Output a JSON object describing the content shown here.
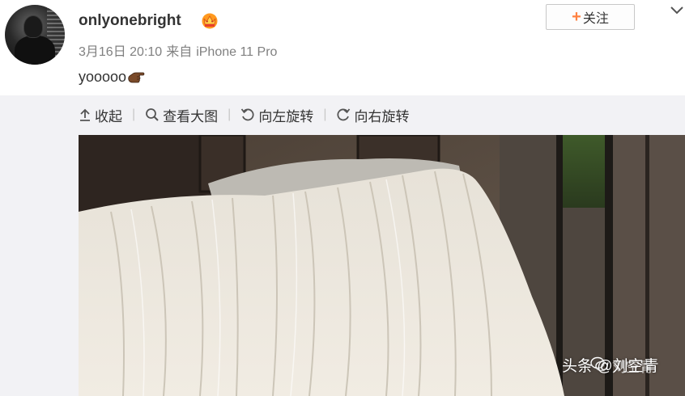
{
  "post": {
    "username": "onlyonebright",
    "meta": {
      "date": "3月16日 20:10",
      "source_prefix": "来自",
      "source": "iPhone 11 Pro"
    },
    "content": "yooooo",
    "follow_label": "关注"
  },
  "toolbar": {
    "collapse": "收起",
    "view_large": "查看大图",
    "rotate_left": "向左旋转",
    "rotate_right": "向右旋转"
  },
  "watermark": {
    "main": "头条 @刘空青",
    "secondary": "刘空青"
  },
  "colors": {
    "accent": "#ff8140",
    "meta_text": "#808080",
    "panel_bg": "#f2f2f5"
  }
}
